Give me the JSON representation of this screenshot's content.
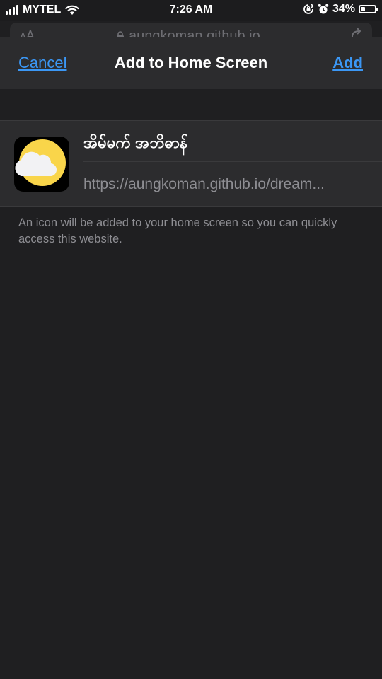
{
  "status_bar": {
    "carrier": "MYTEL",
    "time": "7:26 AM",
    "battery_percent": "34%",
    "battery_level": 0.34
  },
  "browser": {
    "url_text": "aungkoman.github.io"
  },
  "dialog": {
    "cancel_label": "Cancel",
    "title": "Add to Home Screen",
    "add_label": "Add",
    "app_name": "အိမ်မက် အဘိဓာန်",
    "app_url": "https://aungkoman.github.io/dream...",
    "hint": "An icon will be added to your home screen so you can quickly access this website."
  },
  "colors": {
    "accent": "#3b97f5",
    "sun": "#f9d54a",
    "cloud": "#f2f2f4",
    "background": "#1f1f21",
    "panel": "#2c2c2e"
  },
  "icons": [
    "signal-icon",
    "wifi-icon",
    "orientation-lock-icon",
    "alarm-icon",
    "battery-icon",
    "lock-icon",
    "share-icon",
    "weather-icon"
  ]
}
